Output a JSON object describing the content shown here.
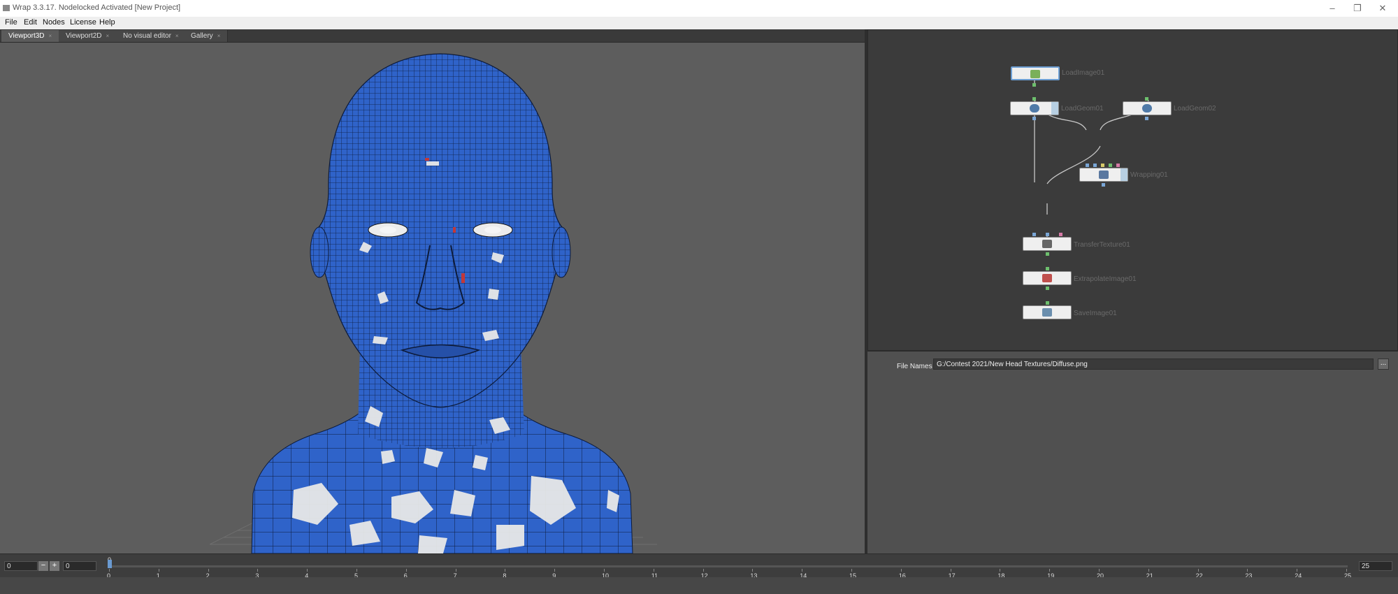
{
  "window": {
    "title": "Wrap 3.3.17. Nodelocked Activated [New Project]",
    "controls": {
      "minimize": "–",
      "maximize": "❐",
      "close": "✕"
    }
  },
  "menu": [
    "File",
    "Edit",
    "Nodes",
    "License",
    "Help"
  ],
  "tabs": [
    {
      "label": "Viewport3D",
      "active": true
    },
    {
      "label": "Viewport2D",
      "active": false
    },
    {
      "label": "No visual editor",
      "active": false
    },
    {
      "label": "Gallery",
      "active": false
    }
  ],
  "tab_close_glyph": "×",
  "nodes": {
    "loadimage": "LoadImage01",
    "loadgeom1": "LoadGeom01",
    "loadgeom2": "LoadGeom02",
    "wrapping": "Wrapping01",
    "transfer": "TransferTexture01",
    "extrapolate": "ExtrapolateImage01",
    "save": "SaveImage01"
  },
  "properties": {
    "file_names_label": "File Names",
    "file_names_value": "G:/Contest 2021/New Head Textures/Diffuse.png",
    "browse_label": "..."
  },
  "timeline": {
    "frame_start": "0",
    "minus": "−",
    "plus": "+",
    "current": "0",
    "cursor_label": "0",
    "frame_end": "25",
    "ticks": [
      "0",
      "1",
      "2",
      "3",
      "4",
      "5",
      "6",
      "7",
      "8",
      "9",
      "10",
      "11",
      "12",
      "13",
      "14",
      "15",
      "16",
      "17",
      "18",
      "19",
      "20",
      "21",
      "22",
      "23",
      "24",
      "25"
    ]
  },
  "colors": {
    "mesh_blue": "#2f63c9",
    "selection_blue": "#6d9fd4",
    "node_bg": "#efefef"
  }
}
